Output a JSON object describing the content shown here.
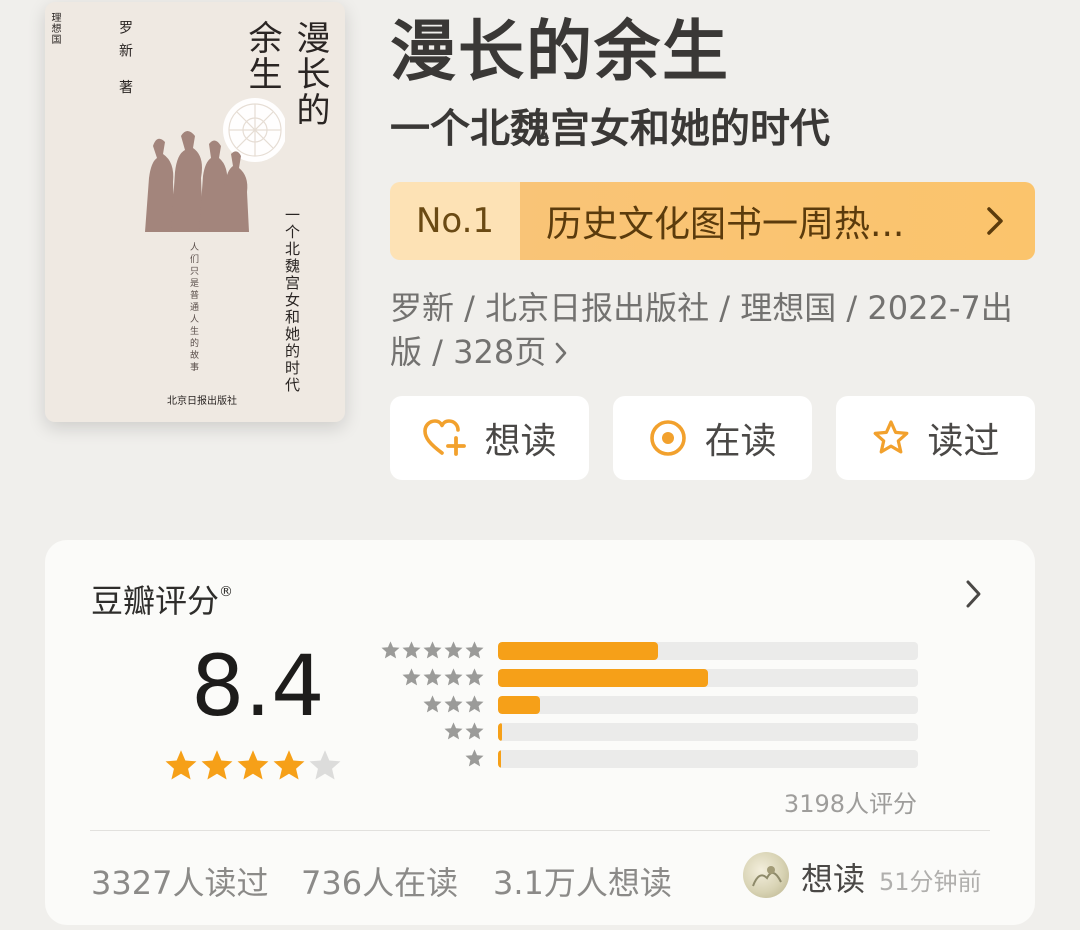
{
  "cover": {
    "publisher_tag": "理想国",
    "author": "罗新 著",
    "title_left": "余生",
    "title_right": "漫长的",
    "subtitle": "一个北魏宫女和她的时代",
    "quote": "人们只是普通人生的故事",
    "publisher": "北京日报出版社"
  },
  "book": {
    "title": "漫长的余生",
    "subtitle": "一个北魏宫女和她的时代"
  },
  "rank": {
    "number": "No.1",
    "text": "历史文化图书一周热...",
    "colors": {
      "left": "#fde2b5",
      "right": "#fbc46c"
    }
  },
  "meta": {
    "text": "罗新 / 北京日报出版社 / 理想国 / 2022-7出版 / 328页"
  },
  "actions": [
    {
      "label": "想读",
      "icon": "heart-plus-icon"
    },
    {
      "label": "在读",
      "icon": "target-circle-icon"
    },
    {
      "label": "读过",
      "icon": "star-outline-icon"
    }
  ],
  "rating": {
    "heading": "豆瓣评分",
    "registered_mark": "®",
    "score": "8.4",
    "stars": 4.2,
    "count_text": "3198人评分",
    "distribution": [
      {
        "stars": 5,
        "fraction": 0.38
      },
      {
        "stars": 4,
        "fraction": 0.5
      },
      {
        "stars": 3,
        "fraction": 0.1
      },
      {
        "stars": 2,
        "fraction": 0.01
      },
      {
        "stars": 1,
        "fraction": 0.005
      }
    ],
    "accent_color": "#f6a018"
  },
  "stats": {
    "read": "3327人读过",
    "reading": "736人在读",
    "want": "3.1万人想读"
  },
  "recent": {
    "label": "想读",
    "time": "51分钟前"
  }
}
